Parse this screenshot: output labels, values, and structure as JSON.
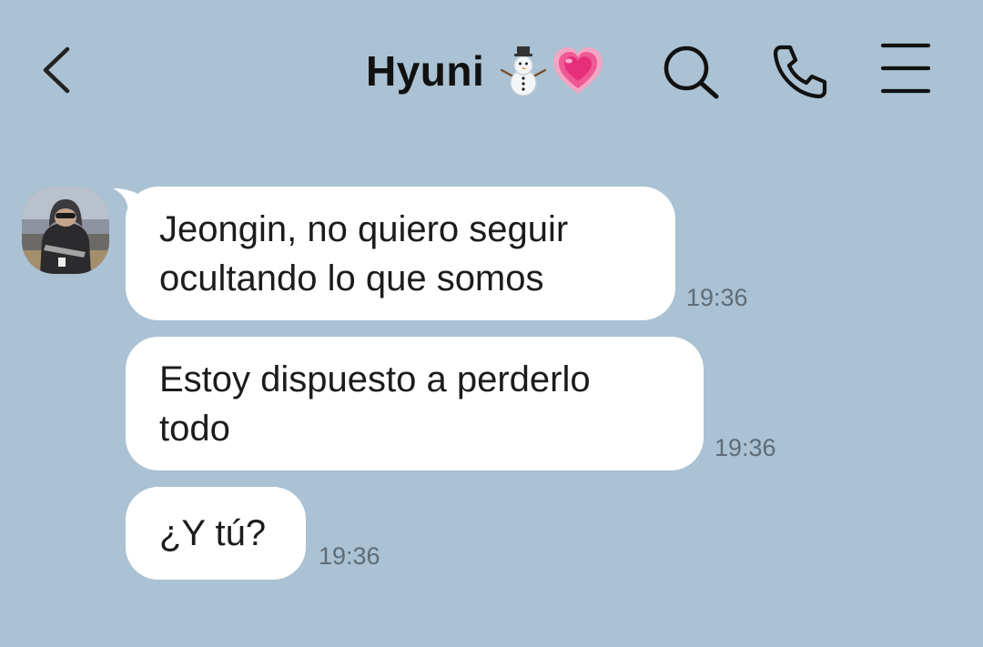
{
  "header": {
    "title": "Hyuni",
    "title_emojis": [
      "snowman-emoji",
      "growing-heart-emoji"
    ],
    "icons": {
      "back": "chevron-left-icon",
      "search": "search-icon",
      "call": "phone-icon",
      "menu": "menu-icon"
    }
  },
  "contact": {
    "avatar": "avatar"
  },
  "messages": [
    {
      "sender": "Hyuni",
      "text": "Jeongin, no quiero seguir\nocultando lo que somos",
      "time": "19:36"
    },
    {
      "sender": "Hyuni",
      "text": "Estoy dispuesto a perderlo\ntodo",
      "time": "19:36"
    },
    {
      "sender": "Hyuni",
      "text": "¿Y tú?",
      "time": "19:36"
    }
  ],
  "colors": {
    "background": "#aac2d3",
    "bubble": "#ffffff",
    "text": "#1c1c1c",
    "timestamp": "#5f6c76",
    "icon": "#111111"
  }
}
